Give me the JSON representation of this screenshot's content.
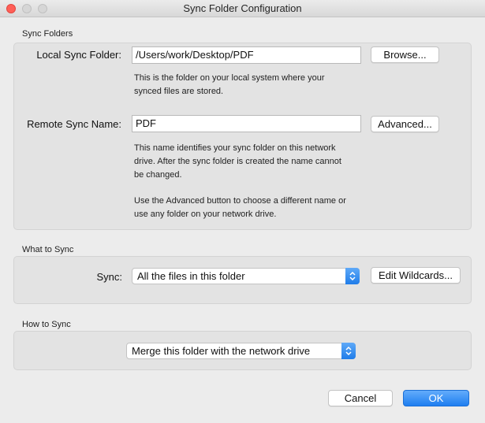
{
  "window": {
    "title": "Sync Folder Configuration"
  },
  "sync_folders": {
    "section_label": "Sync Folders",
    "local_label": "Local Sync Folder:",
    "local_value": "/Users/work/Desktop/PDF",
    "browse_label": "Browse...",
    "local_help_1": "This is the folder on your local system where your",
    "local_help_2": "synced files are stored.",
    "remote_label": "Remote Sync Name:",
    "remote_value": "PDF",
    "advanced_label": "Advanced...",
    "remote_help_1": "This name identifies your sync folder on this network",
    "remote_help_2": "drive. After the sync folder is created the name cannot",
    "remote_help_3": "be changed.",
    "remote_help_4": "Use the Advanced button to choose a different name or",
    "remote_help_5": "use any folder on your network drive."
  },
  "what_to_sync": {
    "section_label": "What to Sync",
    "sync_label": "Sync:",
    "sync_selected": "All the files in this folder",
    "edit_wildcards_label": "Edit Wildcards..."
  },
  "how_to_sync": {
    "section_label": "How to Sync",
    "method_selected": "Merge this folder with the network drive"
  },
  "footer": {
    "cancel_label": "Cancel",
    "ok_label": "OK"
  },
  "colors": {
    "accent": "#1e7ef0",
    "close_button": "#ff5f57"
  },
  "icons": {
    "select_arrow": "chevron-updown-icon"
  }
}
